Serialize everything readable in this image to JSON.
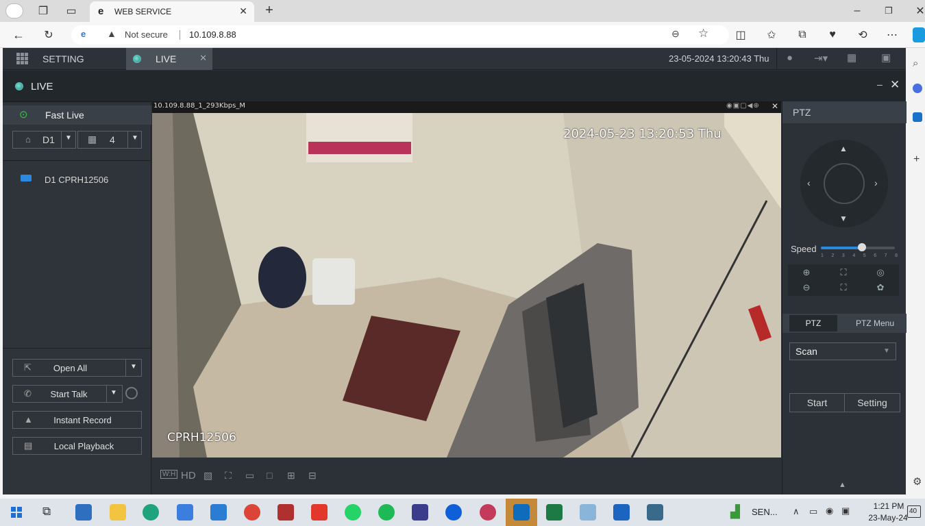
{
  "browser": {
    "tab_title": "WEB SERVICE",
    "security_label": "Not secure",
    "url": "10.109.8.88"
  },
  "app": {
    "nav_setting": "SETTING",
    "nav_live": "LIVE",
    "datetime": "23-05-2024 13:20:43 Thu",
    "live_title": "LIVE"
  },
  "left_panel": {
    "fast_live": "Fast Live",
    "device_select": "D1",
    "split_select": "4",
    "channel": "D1 CPRH12506",
    "buttons": {
      "open_all": "Open All",
      "start_talk": "Start Talk",
      "instant_record": "Instant Record",
      "local_playback": "Local Playback"
    }
  },
  "video": {
    "caption": "10.109.8.88_1_293Kbps_M",
    "osd_time": "2024-05-23 13:20:53 Thu",
    "osd_name": "CPRH12506",
    "tools": {
      "wh": "W:H",
      "hd": "HD"
    }
  },
  "ptz": {
    "header": "PTZ",
    "speed_label": "Speed",
    "speed_level": 5,
    "speed_ticks": [
      "1",
      "2",
      "3",
      "4",
      "5",
      "6",
      "7",
      "8"
    ],
    "tab_ptz": "PTZ",
    "tab_menu": "PTZ Menu",
    "mode_select": "Scan",
    "start": "Start",
    "setting": "Setting"
  },
  "taskbar": {
    "tray_label": "SEN...",
    "time": "1:21 PM",
    "date": "23-May-24",
    "notif_count": "40"
  }
}
